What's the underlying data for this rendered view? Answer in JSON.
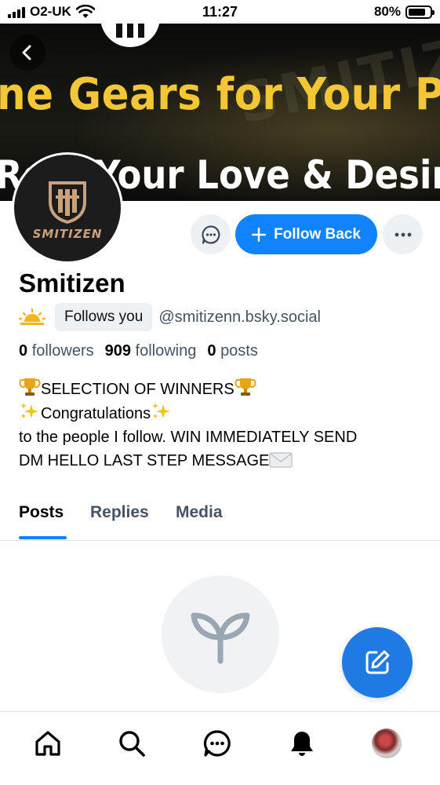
{
  "status_bar": {
    "carrier": "O2-UK",
    "time": "11:27",
    "battery_percent": "80%",
    "battery_level": 0.8,
    "icons": [
      "signal-icon",
      "wifi-icon",
      "battery-icon"
    ]
  },
  "banner": {
    "line1": "ne Gears for Your Pla",
    "line2": "Re   e Your Love & Desir"
  },
  "avatar": {
    "wordmark": "SMITIZEN"
  },
  "actions": {
    "follow_back_label": "Follow Back"
  },
  "profile": {
    "display_name": "Smitizen",
    "follows_you_label": "Follows you",
    "handle": "@smitizenn.bsky.social",
    "followers_count": "0",
    "followers_label": "followers",
    "following_count": "909",
    "following_label": "following",
    "posts_count": "0",
    "posts_label": "posts",
    "bio": {
      "line1": "SELECTION OF WINNERS",
      "line2": "Congratulations",
      "line3": "to the people I follow. WIN IMMEDIATELY SEND",
      "line4": "DM HELLO LAST STEP MESSAGE"
    }
  },
  "tabs": [
    {
      "label": "Posts",
      "active": true
    },
    {
      "label": "Replies",
      "active": false
    },
    {
      "label": "Media",
      "active": false
    }
  ],
  "colors": {
    "accent": "#1083fe",
    "fab": "#1f7be3",
    "secondary_text": "#425466"
  },
  "bottom_nav": [
    "home-icon",
    "search-icon",
    "chat-icon",
    "bell-icon",
    "profile-avatar"
  ]
}
